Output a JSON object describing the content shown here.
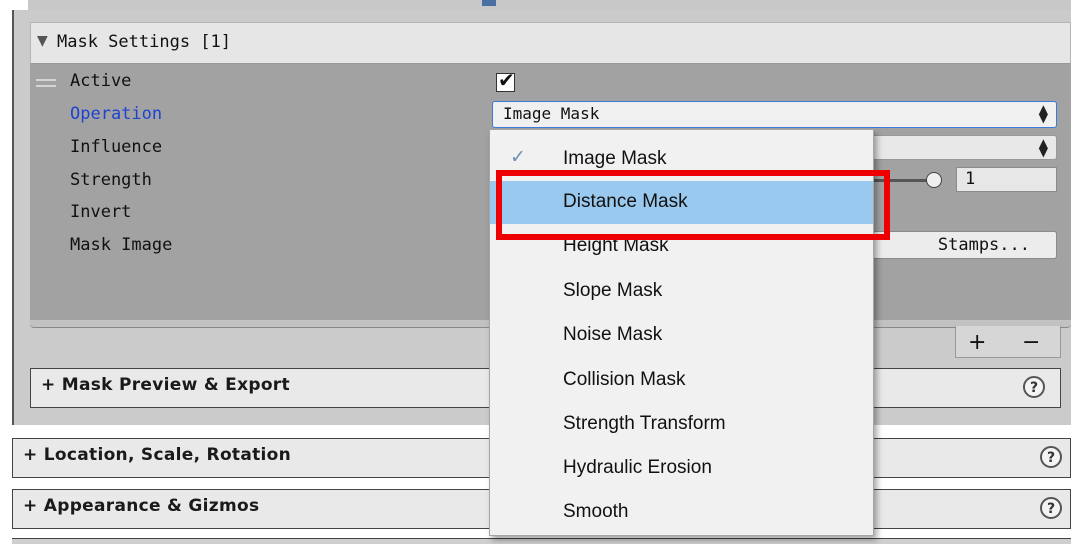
{
  "mask_settings": {
    "title": "Mask Settings [1]",
    "active_label": "Active",
    "operation_label": "Operation",
    "influence_label": "Influence",
    "strength_label": "Strength",
    "invert_label": "Invert",
    "mask_image_label": "Mask Image",
    "operation_value": "Image Mask",
    "active_checked": true,
    "strength_value": "1",
    "stamps_button": "Stamps...",
    "plus": "+",
    "minus": "−"
  },
  "sections": {
    "preview": "+ Mask Preview & Export",
    "location": "+ Location, Scale, Rotation",
    "appearance": "+ Appearance & Gizmos"
  },
  "help_symbol": "?",
  "dropdown": {
    "selected_index": 0,
    "highlighted_index": 1,
    "items": [
      "Image Mask",
      "Distance Mask",
      "Height Mask",
      "Slope Mask",
      "Noise Mask",
      "Collision Mask",
      "Strength Transform",
      "Hydraulic Erosion",
      "Smooth"
    ]
  },
  "colors": {
    "highlight_border": "#ee0000",
    "hover_bg": "#99c9ef",
    "operation_label": "#1e43d0"
  }
}
